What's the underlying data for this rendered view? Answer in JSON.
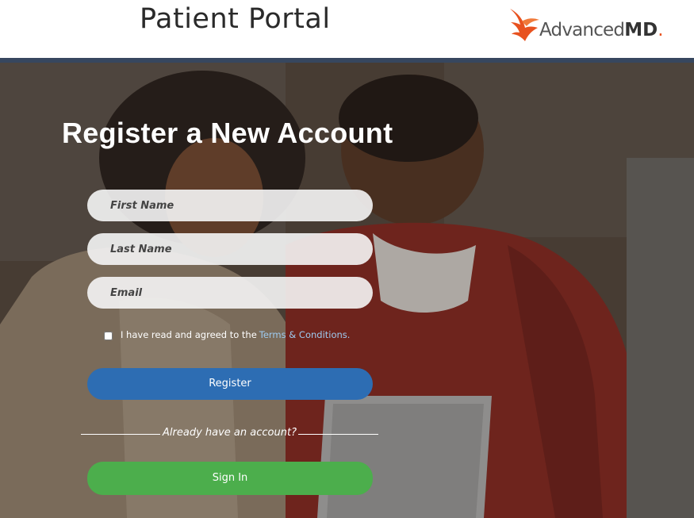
{
  "header": {
    "title": "Patient Portal",
    "logo": {
      "text_light": "Advanced",
      "text_bold": "MD",
      "icon": "bird-logo-icon",
      "accent_color": "#e8521f"
    }
  },
  "hero": {
    "image": "couple-with-laptop-photo"
  },
  "form": {
    "heading": "Register a New Account",
    "first_name_placeholder": "First Name",
    "last_name_placeholder": "Last Name",
    "email_placeholder": "Email",
    "terms_prefix": "I have read and agreed to the",
    "terms_link": "Terms & Conditions.",
    "terms_checked": false,
    "register_label": "Register",
    "already_label": "Already have an account?",
    "signin_label": "Sign In"
  },
  "colors": {
    "header_bar": "#37475f",
    "register_button": "#2d6db3",
    "signin_button": "#4cae4c",
    "link": "#9ecbf0"
  }
}
